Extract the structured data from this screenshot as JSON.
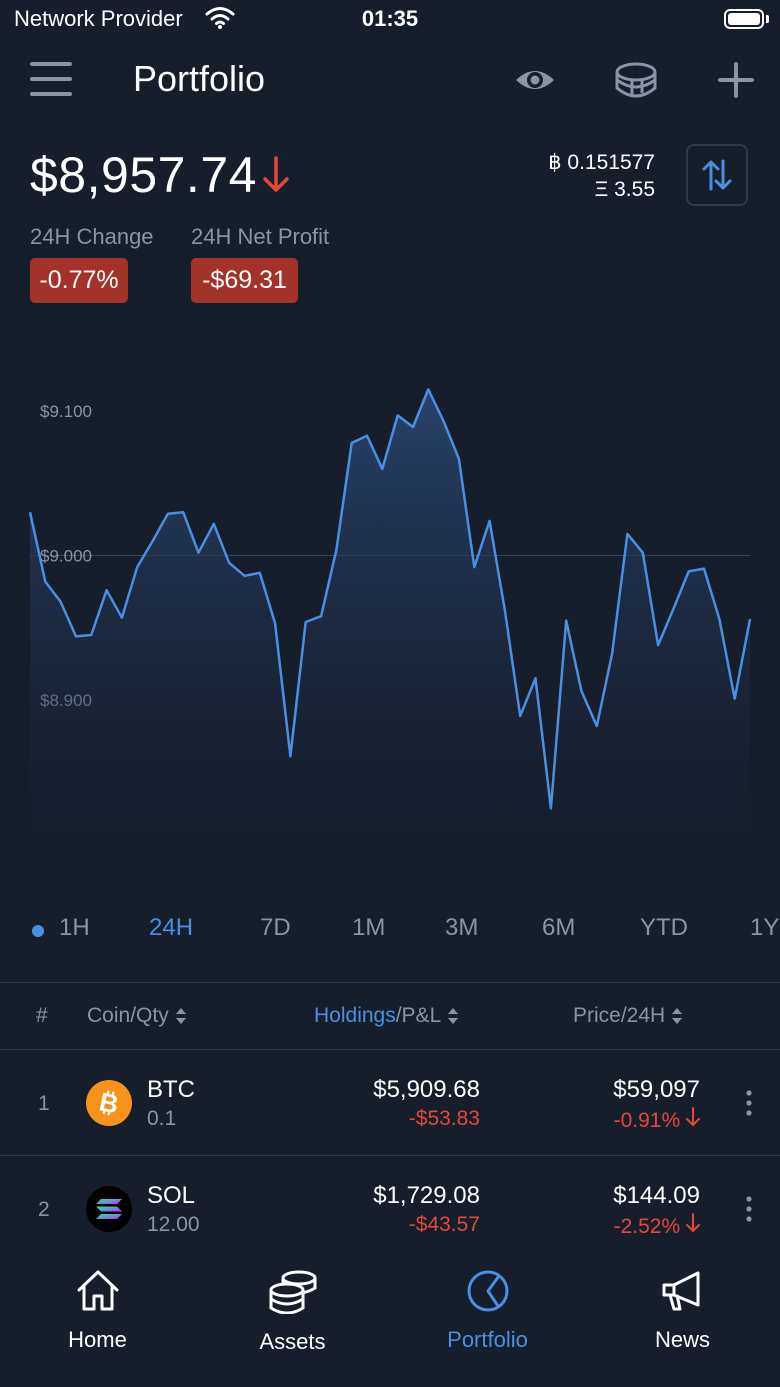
{
  "status_bar": {
    "carrier": "Network Provider",
    "time": "01:35"
  },
  "header": {
    "title": "Portfolio",
    "icons": [
      "menu-icon",
      "eye-icon",
      "coins-icon",
      "plus-icon"
    ]
  },
  "summary": {
    "balance": "$8,957.74",
    "btc_amount": "฿ 0.151577",
    "eth_amount": "Ξ 3.55",
    "change_label": "24H Change",
    "change_value": "-0.77%",
    "profit_label": "24H Net Profit",
    "profit_value": "-$69.31"
  },
  "colors": {
    "accent": "#4a90e2",
    "negative": "#e4473c",
    "badge_negative": "#a33228",
    "background": "#161d2b"
  },
  "chart_data": {
    "type": "area",
    "x": [
      0,
      1,
      2,
      3,
      4,
      5,
      6,
      7,
      8,
      9,
      10,
      11,
      12,
      13,
      14,
      15,
      16,
      17,
      18,
      19,
      20,
      21,
      22,
      23,
      24,
      25,
      26,
      27,
      28,
      29,
      30,
      31,
      32,
      33,
      34,
      35,
      36,
      37,
      38,
      39,
      40,
      41,
      42,
      43,
      44,
      45,
      46,
      47
    ],
    "values": [
      9030,
      8982,
      8968,
      8944,
      8945,
      8976,
      8957,
      8992,
      9010,
      9029,
      9030,
      9002,
      9022,
      8995,
      8986,
      8988,
      8953,
      8861,
      8954,
      8958,
      9004,
      9078,
      9083,
      9060,
      9097,
      9089,
      9115,
      9093,
      9067,
      8992,
      9024,
      8962,
      8889,
      8915,
      8825,
      8955,
      8906,
      8882,
      8932,
      9015,
      9002,
      8938,
      8963,
      8989,
      8991,
      8956,
      8901,
      8956
    ],
    "yticks": [
      {
        "value": 9100,
        "label": "$9.100"
      },
      {
        "value": 9000,
        "label": "$9.000"
      },
      {
        "value": 8900,
        "label": "$8.900"
      }
    ],
    "ylim": [
      8810,
      9125
    ],
    "grid": "single line at $9.000",
    "line_color": "#4a90e2"
  },
  "ranges": {
    "items": [
      "1H",
      "24H",
      "7D",
      "1M",
      "3M",
      "6M",
      "YTD",
      "1Y"
    ],
    "active": "24H"
  },
  "table": {
    "headers": {
      "rank": "#",
      "coin": "Coin/Qty",
      "holdings": "Holdings",
      "pl": "/P&L",
      "price": "Price/24H"
    },
    "rows": [
      {
        "rank": "1",
        "symbol": "BTC",
        "qty": "0.1",
        "holdings": "$5,909.68",
        "pnl": "-$53.83",
        "price": "$59,097",
        "change": "-0.91%",
        "icon": "bitcoin-icon",
        "icon_color": "#f7931a"
      },
      {
        "rank": "2",
        "symbol": "SOL",
        "qty": "12.00",
        "holdings": "$1,729.08",
        "pnl": "-$43.57",
        "price": "$144.09",
        "change": "-2.52%",
        "icon": "solana-icon",
        "icon_color": "#000000"
      }
    ]
  },
  "nav": {
    "items": [
      {
        "label": "Home",
        "icon": "home-icon"
      },
      {
        "label": "Assets",
        "icon": "coins-stack-icon"
      },
      {
        "label": "Portfolio",
        "icon": "pie-chart-icon"
      },
      {
        "label": "News",
        "icon": "megaphone-icon"
      }
    ],
    "active": "Portfolio"
  }
}
